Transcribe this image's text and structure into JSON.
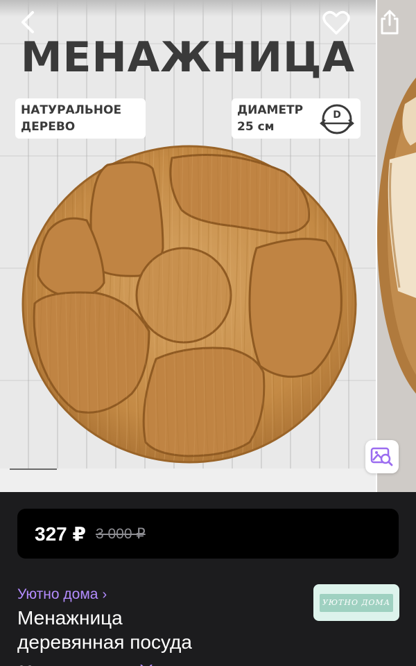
{
  "gallery": {
    "hero_title": "МЕНАЖНИЦА",
    "chip_left": [
      "НАТУРАЛЬНОЕ",
      "ДЕРЕВО"
    ],
    "chip_right": [
      "ДИАМЕТР",
      "25 см"
    ],
    "diameter_icon_letter": "D",
    "icons": {
      "back": "chevron-left-icon",
      "favorite": "heart-icon",
      "share": "share-icon",
      "visual_search": "image-search-icon"
    }
  },
  "price": {
    "current": "327 ₽",
    "old": "3 000 ₽"
  },
  "product": {
    "seller": "Уютно дома",
    "seller_chevron": "›",
    "title_lines": [
      "Менажница",
      "деревянная посуда"
    ],
    "seller_logo_text": "УЮТНО ДОМА"
  },
  "colors": {
    "background": "#1c1c1e",
    "accent": "#b38cff",
    "price_card": "#000000",
    "old_price": "#8e8e93"
  }
}
